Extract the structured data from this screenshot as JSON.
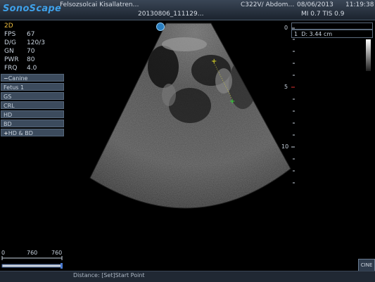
{
  "header": {
    "brand": "SonoScape",
    "patient": "Felsozsolcai Kisallatren…",
    "probe": "C322V/ Abdom…",
    "date": "08/06/2013",
    "time": "11:19:38",
    "image_id": "20130806_111129…",
    "indices": "MI 0.7  TIS 0.9"
  },
  "params": {
    "mode": "2D",
    "items": [
      {
        "key": "FPS",
        "value": "67"
      },
      {
        "key": "D/G",
        "value": "120/3"
      },
      {
        "key": "GN",
        "value": "70"
      },
      {
        "key": "PWR",
        "value": "80"
      },
      {
        "key": "FRQ",
        "value": "4.0"
      }
    ]
  },
  "menu": {
    "items": [
      {
        "prefix": "−",
        "label": "Canine"
      },
      {
        "prefix": "",
        "label": "Fetus 1"
      },
      {
        "prefix": "",
        "label": "GS"
      },
      {
        "prefix": "",
        "label": "CRL"
      },
      {
        "prefix": "",
        "label": "HD"
      },
      {
        "prefix": "",
        "label": "BD"
      },
      {
        "prefix": "+",
        "label": "HD & BD"
      }
    ]
  },
  "measurement": {
    "index": "1",
    "label": "D: 3.44   cm"
  },
  "depth_scale": [
    "0",
    "5",
    "10"
  ],
  "scale": {
    "left": "0",
    "mid": "760",
    "right": "760"
  },
  "status": {
    "text": "Distance: [Set]Start Point"
  },
  "cine": {
    "label": "CINE"
  },
  "colors": {
    "accent": "#3fa0e8",
    "mode": "#f0c040",
    "caliper_yellow": "#e6e020",
    "caliper_green": "#30e030"
  }
}
